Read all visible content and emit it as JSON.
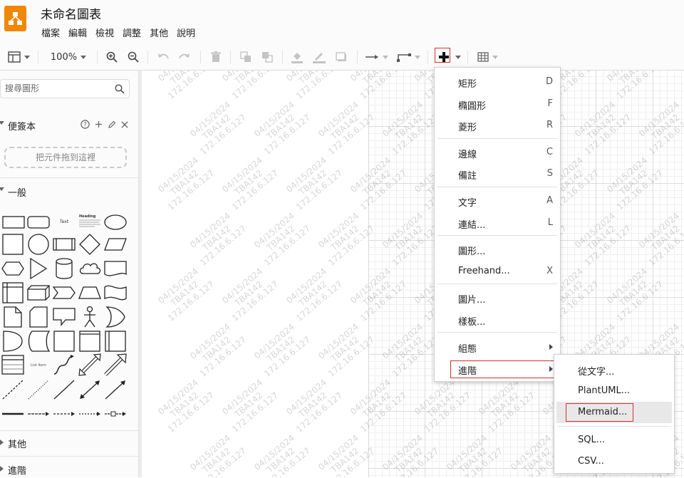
{
  "app": {
    "title": "未命名圖表",
    "menu": [
      "檔案",
      "編輯",
      "檢視",
      "調整",
      "其他",
      "說明"
    ]
  },
  "toolbar": {
    "zoom": "100%",
    "icons": [
      "view-panels-icon",
      "zoom-in-icon",
      "zoom-out-icon",
      "undo-icon",
      "redo-icon",
      "delete-icon",
      "to-front-icon",
      "to-back-icon",
      "fill-color-icon",
      "line-color-icon",
      "shadow-icon",
      "connection-icon",
      "waypoints-icon",
      "insert-plus-icon",
      "table-icon"
    ]
  },
  "sidebar": {
    "search_placeholder": "搜尋圖形",
    "scratchpad": {
      "title": "便簽本",
      "drop_hint": "把元件拖到這裡"
    },
    "general_title": "一般",
    "shape_text_label": "Text",
    "shape_heading_label": "Heading",
    "shape_list_label": "List Item",
    "other_title": "其他",
    "advanced_title": "進階"
  },
  "watermark": {
    "date": "04/15/2024",
    "id": "TBA142",
    "ip": "172.16.6.127"
  },
  "insert_menu": {
    "items": [
      {
        "label": "矩形",
        "key": "D"
      },
      {
        "label": "橢圓形",
        "key": "F"
      },
      {
        "label": "菱形",
        "key": "R"
      },
      {
        "label": "邊線",
        "key": "C"
      },
      {
        "label": "備註",
        "key": "S"
      },
      {
        "label": "文字",
        "key": "A"
      },
      {
        "label": "連結...",
        "key": "L"
      },
      {
        "label": "圖形...",
        "key": ""
      },
      {
        "label": "Freehand...",
        "key": "X"
      },
      {
        "label": "圖片...",
        "key": ""
      },
      {
        "label": "樣板...",
        "key": ""
      },
      {
        "label": "組態",
        "key": ""
      },
      {
        "label": "進階",
        "key": ""
      }
    ]
  },
  "advanced_submenu": {
    "items": [
      "從文字...",
      "PlantUML...",
      "Mermaid...",
      "SQL...",
      "CSV..."
    ]
  },
  "colors": {
    "brand": "#f08705",
    "highlight": "#d32f2f"
  }
}
